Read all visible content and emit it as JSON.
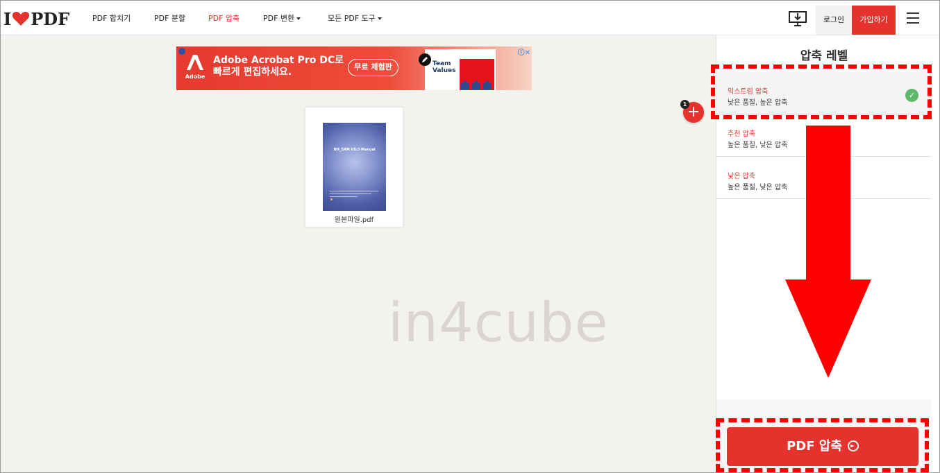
{
  "nav": {
    "logo_prefix": "I",
    "logo_suffix": "PDF",
    "links": [
      "PDF 합치기",
      "PDF 분할",
      "PDF 압축",
      "PDF 변환",
      "모든 PDF 도구"
    ],
    "login": "로그인",
    "signup": "가입하기"
  },
  "ad": {
    "brand": "Adobe",
    "headline_1": "Adobe Acrobat Pro DC로",
    "headline_2": "빠르게 편집하세요.",
    "cta": "무료 체험판",
    "card_text_1": "Team",
    "card_text_2": "Values"
  },
  "file": {
    "name": "원본파일.pdf",
    "thumb_title": "NH_SAM V8.0 Manual"
  },
  "add_badge": "1",
  "watermark": "in4cube",
  "sidebar": {
    "title": "압축 레벨",
    "options": [
      {
        "title": "익스트림 압축",
        "desc": "낮은 품질, 높은 압축"
      },
      {
        "title": "추천 압축",
        "desc": "높은 품질, 낮은 압축"
      },
      {
        "title": "낮은 압축",
        "desc": "높은 품질, 낮은 압축"
      }
    ],
    "compress_label": "PDF 압축"
  },
  "colors": {
    "brand_red": "#e5322d",
    "annotation_red": "#ff0000",
    "check_green": "#5cba6a"
  }
}
